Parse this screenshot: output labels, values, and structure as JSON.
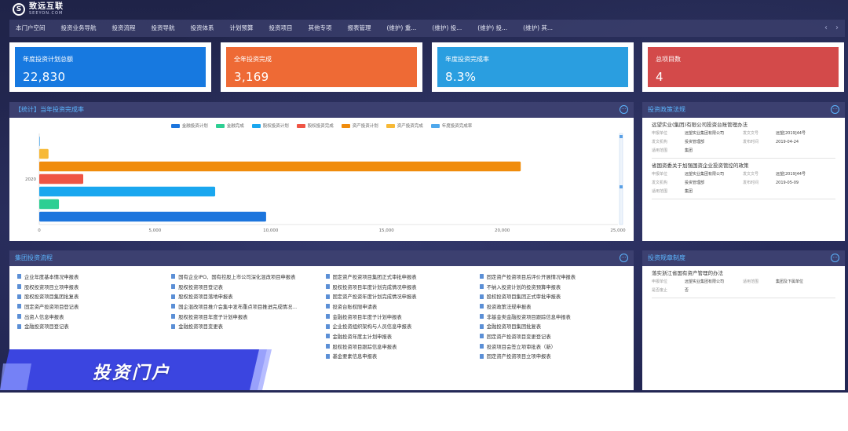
{
  "logo": {
    "cn": "致远互联",
    "en": "SEEYON.COM"
  },
  "nav": {
    "items": [
      "本门户空间",
      "投资业务导航",
      "投资流程",
      "投资导航",
      "投资体系",
      "计划预算",
      "投资项目",
      "其他专项",
      "报表管理",
      "(维护) 重...",
      "(维护) 投...",
      "(维护) 投...",
      "(维护) 其..."
    ],
    "prev": "‹",
    "next": "›"
  },
  "stats": [
    {
      "label": "年度投资计划总额",
      "value": "22,830",
      "color": "#1779e0"
    },
    {
      "label": "全年投资完成",
      "value": "3,169",
      "color": "#ee6a35"
    },
    {
      "label": "年度投资完成率",
      "value": "8.3%",
      "color": "#2a9ee0"
    },
    {
      "label": "总项目数",
      "value": "4",
      "color": "#d34a4a"
    }
  ],
  "chart_panel": {
    "title": "【统计】当年投资完成率"
  },
  "chart_data": {
    "type": "bar",
    "orientation": "horizontal",
    "categories": [
      "2020"
    ],
    "series": [
      {
        "name": "金融投资计划",
        "values": [
          9800
        ],
        "color": "#1c75dd"
      },
      {
        "name": "金融完成",
        "values": [
          850
        ],
        "color": "#2dcf93"
      },
      {
        "name": "股权投资计划",
        "values": [
          7600
        ],
        "color": "#1aa7ef"
      },
      {
        "name": "股权投资完成",
        "values": [
          1900
        ],
        "color": "#ef5444"
      },
      {
        "name": "资产投资计划",
        "values": [
          20800
        ],
        "color": "#f08c0c"
      },
      {
        "name": "资产投资完成",
        "values": [
          400
        ],
        "color": "#f7b936"
      },
      {
        "name": "年度投资完成率",
        "values": [
          8.3
        ],
        "color": "#4fa8ec"
      }
    ],
    "xlim": [
      0,
      25000
    ],
    "xticks": [
      "0",
      "5,000",
      "10,000",
      "15,000",
      "20,000",
      "25,000"
    ],
    "legend_position": "top",
    "grid": false
  },
  "policy_panel": {
    "title": "投资政策法规",
    "items": [
      {
        "title": "远望实业(集团)有限公司投资台账管理办法",
        "rows": [
          [
            "申报单位",
            "远望实业集团有限公司",
            "发文文号",
            "远望[2019]44号"
          ],
          [
            "发文机构",
            "投资管理部",
            "发布时间",
            "2019-04-24"
          ],
          [
            "适用范围",
            "集团",
            "",
            ""
          ]
        ]
      },
      {
        "title": "省国资委关于加强国资企业投资管控的政策",
        "rows": [
          [
            "申报单位",
            "远望实业集团有限公司",
            "发文文号",
            "远望[2019]44号"
          ],
          [
            "发文机构",
            "投资管理部",
            "发布时间",
            "2019-05-09"
          ],
          [
            "适用范围",
            "集团",
            "",
            ""
          ]
        ]
      }
    ]
  },
  "process_panel": {
    "title": "集团投资流程",
    "items": [
      "企业年度基本情况申报表",
      "国有企业IPO、国有控股上市公司深化混改项目申报表",
      "固定资产投资项目集团正式审批申报表",
      "固定资产投资项目后评价开展情况申报表",
      "股权投资项目立项申报表",
      "股权投资项目登记表",
      "股权投资项目年度计划完成情况申报表",
      "不纳入投资计划的投资预算申报表",
      "股权投资项目集团批复表",
      "股权投资项目落地申报表",
      "固定资产投资年度计划完成情况申报表",
      "股权投资项目集团正式审批申报表",
      "固定资产投资项目登记表",
      "国企混改项目推介会集中发布重点项目推进完成情况...",
      "投资台账权限申请表",
      "投资政策法规申报表",
      "出资人信息申报表",
      "股权投资项目年度子计划申报表",
      "金融投资项目年度子计划申报表",
      "非基金类金融投资项目跟踪信息申报表",
      "金融投资项目登记表",
      "金融投资项目变更表",
      "企业投资组织架构与人员信息申报表",
      "金融投资项目集团批复表",
      "",
      "",
      "金融投资年度主计划申报表",
      "固定资产投资项目变更登记表",
      "",
      "",
      "股权投资项目跟踪信息申报表",
      "投资项目会签立项审批表（新）",
      "",
      "",
      "基金要素信息申报表",
      "固定资产投资项目立项申报表"
    ]
  },
  "rules_panel": {
    "title": "投资规章制度",
    "items": [
      {
        "title": "落实浙江省国有资产管理的办法",
        "rows": [
          [
            "申报单位",
            "远望实业集团有限公司",
            "适用范围",
            "集团及下属单位"
          ],
          [
            "是否废止",
            "否",
            "",
            ""
          ]
        ]
      }
    ]
  },
  "banner": {
    "text": "投资门户"
  },
  "more_icon": "ellipsis-circle-icon"
}
